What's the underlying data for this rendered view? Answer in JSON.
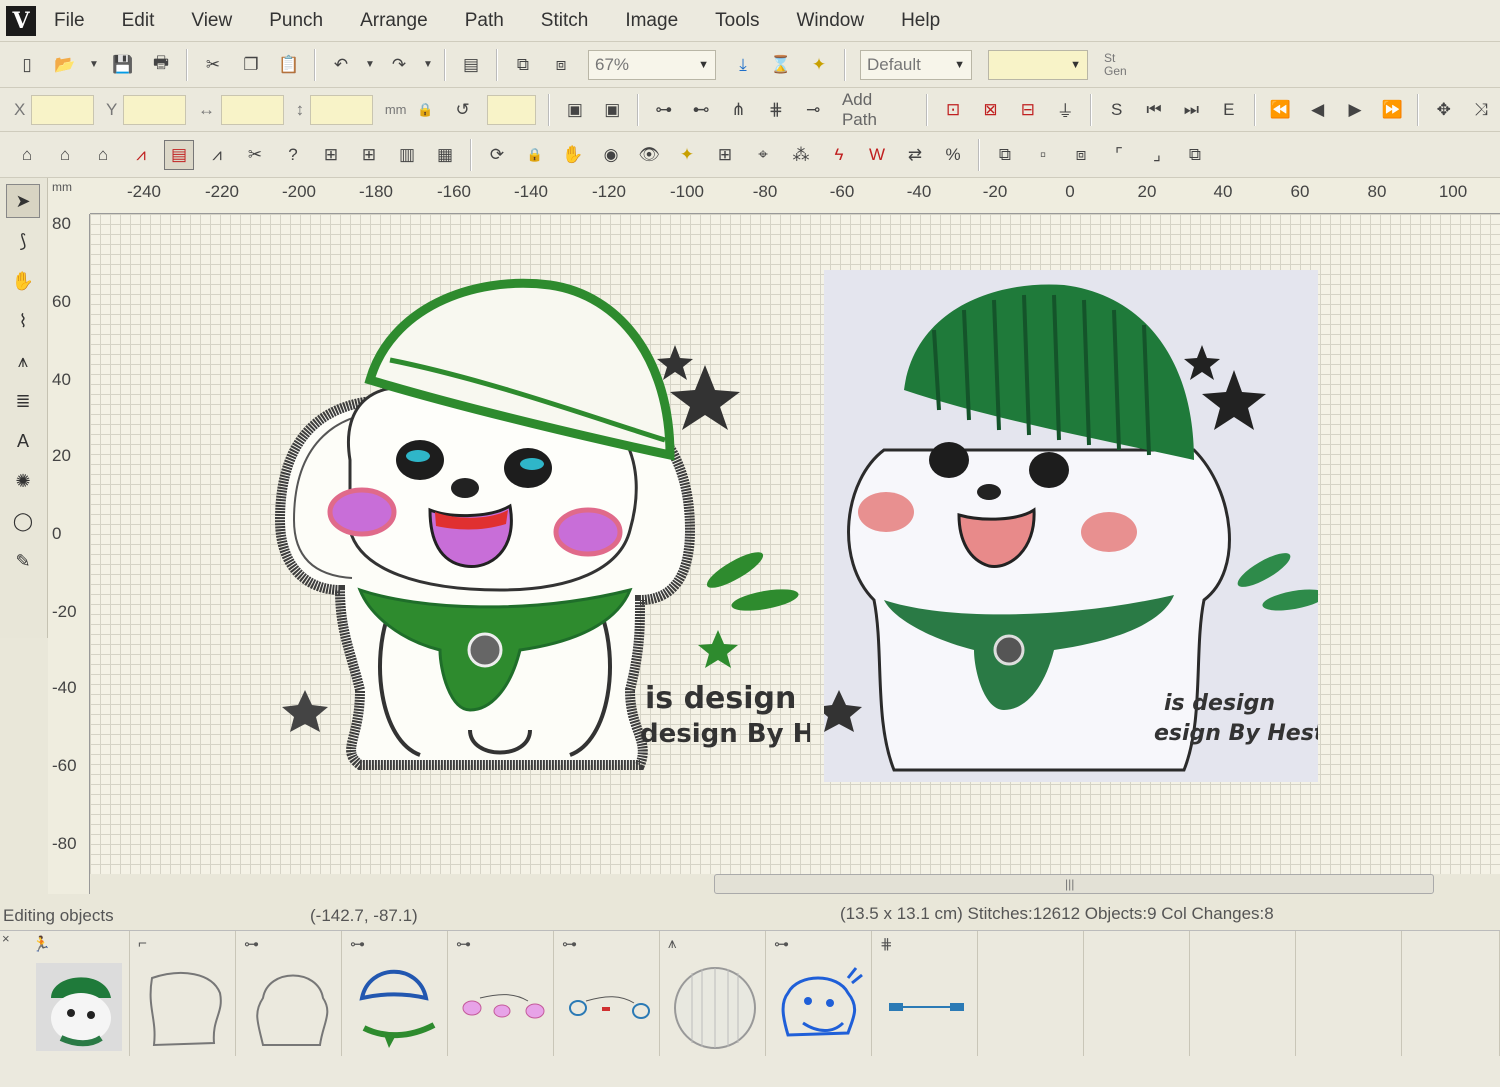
{
  "menu": [
    "File",
    "Edit",
    "View",
    "Punch",
    "Arrange",
    "Path",
    "Stitch",
    "Image",
    "Tools",
    "Window",
    "Help"
  ],
  "toolbar": {
    "zoom": "67%",
    "style_combo": "Default",
    "color_combo": "",
    "st_gen": [
      "St",
      "Gen"
    ],
    "x_label": "X",
    "y_label": "Y",
    "unit": "mm",
    "angle_unit": "°",
    "add_path": "Add Path",
    "seq_s": "S",
    "seq_e": "E"
  },
  "ruler": {
    "unit": "mm",
    "top_ticks": [
      "-240",
      "-220",
      "-200",
      "-180",
      "-160",
      "-140",
      "-120",
      "-100",
      "-80",
      "-60",
      "-40",
      "-20",
      "0",
      "20",
      "40",
      "60",
      "80",
      "100"
    ],
    "left_ticks": [
      "80",
      "60",
      "40",
      "20",
      "0",
      "-20",
      "-40",
      "-60",
      "-80"
    ]
  },
  "design": {
    "text_line1": "is design",
    "text_line2": "design By Hest",
    "photo_text1": "is design",
    "photo_text2": "esign By Hest"
  },
  "status": {
    "mode": "Editing objects",
    "coords": "(-142.7, -87.1)",
    "info": "(13.5 x 13.1 cm) Stitches:12612 Objects:9 Col Changes:8"
  },
  "objects_panel": {
    "count": 9,
    "icons": [
      "figure-icon",
      "outline-icon",
      "satin-icon",
      "satin-icon",
      "satin-icon",
      "satin-icon",
      "fill-icon",
      "satin-icon",
      "run-icon"
    ]
  },
  "colors": {
    "green": "#2e8b2e",
    "dark_green": "#1f6e2a",
    "outline": "#444444",
    "pink": "#e06a8a",
    "purple": "#c86ed8",
    "cyan": "#2fb6c9"
  }
}
